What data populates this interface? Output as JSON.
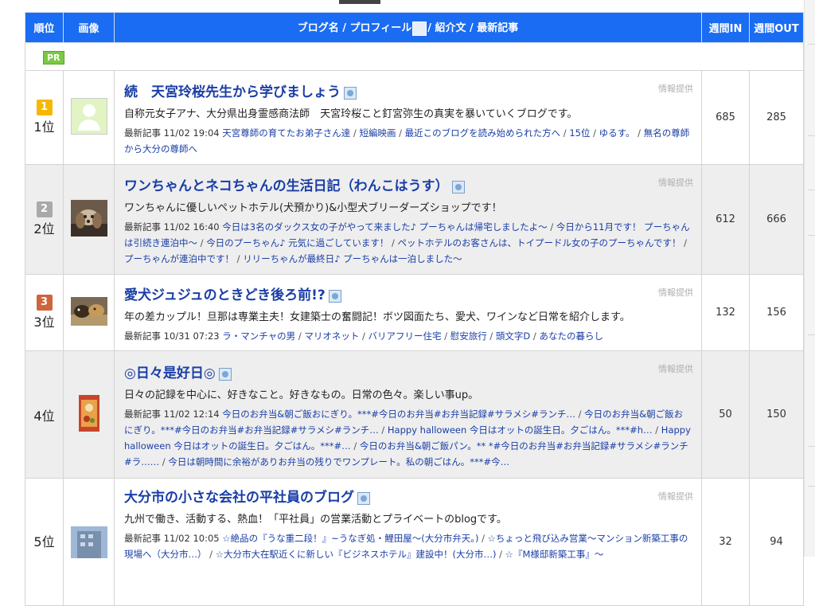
{
  "header": {
    "rank": "順位",
    "image": "画像",
    "blog_a": "ブログ名 / プロフィール",
    "blog_b": "/ 紹介文 / 最新記事",
    "week_in": "週間IN",
    "week_out": "週間OUT"
  },
  "pr_label": "PR",
  "info_label": "情報提供",
  "latest_prefix": "最新記事",
  "rows": [
    {
      "rank": "1位",
      "badge": "1",
      "title": "続　天宮玲桜先生から学びましょう",
      "description": "自称元女子アナ、大分県出身霊感商法師　天宮玲桜こと釘宮弥生の真実を暴いていくブログです。",
      "date": "11/02 19:04",
      "articles": [
        "天宮尊師の育てたお弟子さん達",
        "短編映画",
        "最近このブログを読み始められた方へ",
        "15位",
        "ゆるす。",
        "無名の尊師から大分の尊師へ"
      ],
      "in": "685",
      "out": "285"
    },
    {
      "rank": "2位",
      "badge": "2",
      "title": "ワンちゃんとネコちゃんの生活日記（わんこはうす）",
      "description": "ワンちゃんに優しいペットホテル(犬預かり)&小型犬ブリーダーズショップです！",
      "date": "11/02 16:40",
      "articles": [
        "今日は3名のダックス女の子がやって来ました♪ プーちゃんは帰宅しましたよ～",
        "今日から11月です！ プーちゃんは引続き連泊中～",
        "今日のプーちゃん♪ 元気に過ごしています！",
        "ペットホテルのお客さんは、トイプードル女の子のプーちゃんです！",
        "プーちゃんが連泊中です！",
        "リリーちゃんが最終日♪ プーちゃんは一泊しました～"
      ],
      "in": "612",
      "out": "666"
    },
    {
      "rank": "3位",
      "badge": "3",
      "title": "愛犬ジュジュのときどき後ろ前!?",
      "description": "年の差カップル！旦那は専業主夫！女建築士の奮闘記！ボツ図面たち、愛犬、ワインなど日常を紹介します。",
      "date": "10/31 07:23",
      "articles": [
        "ラ・マンチャの男",
        "マリオネット",
        "バリアフリー住宅",
        "慰安旅行",
        "頭文字D",
        "あなたの暮らし"
      ],
      "in": "132",
      "out": "156"
    },
    {
      "rank": "4位",
      "badge": "",
      "title": "◎日々是好日◎",
      "description": "日々の記録を中心に、好きなこと。好きなもの。日常の色々。楽しい事up。",
      "date": "11/02 12:14",
      "articles": [
        "今日のお弁当&朝ご飯おにぎり。***#今日のお弁当#お弁当記録#サラメシ#ランチ…",
        "今日のお弁当&朝ご飯おにぎり。***#今日のお弁当#お弁当記録#サラメシ#ランチ…",
        "Happy halloween 今日はオットの誕生日。夕ごはん。***#h…",
        "Happy halloween 今日はオットの誕生日。夕ごはん。***#…",
        "今日のお弁当&朝ご飯パン。** *#今日のお弁当#お弁当記録#サラメシ#ランチ#ラ……",
        "今日は朝時間に余裕がありお弁当の残りでワンプレート。私の朝ごはん。***#今…"
      ],
      "in": "50",
      "out": "150"
    },
    {
      "rank": "5位",
      "badge": "",
      "title": "大分市の小さな会社の平社員のブログ",
      "description": "九州で働き、活動する、熱血！「平社員」の営業活動とプライベートのblogです。",
      "date": "11/02 10:05",
      "articles": [
        "☆絶品の『うな重二段！』~うなぎ処・鯉田屋～(大分市弁天。)",
        "☆ちょっと飛び込み営業～マンション新築工事の現場へ（大分市…）",
        "☆大分市大在駅近くに新しい『ビジネスホテル』建設中！(大分市…)",
        "☆『M様邸新築工事』～"
      ],
      "in": "32",
      "out": "94"
    }
  ]
}
